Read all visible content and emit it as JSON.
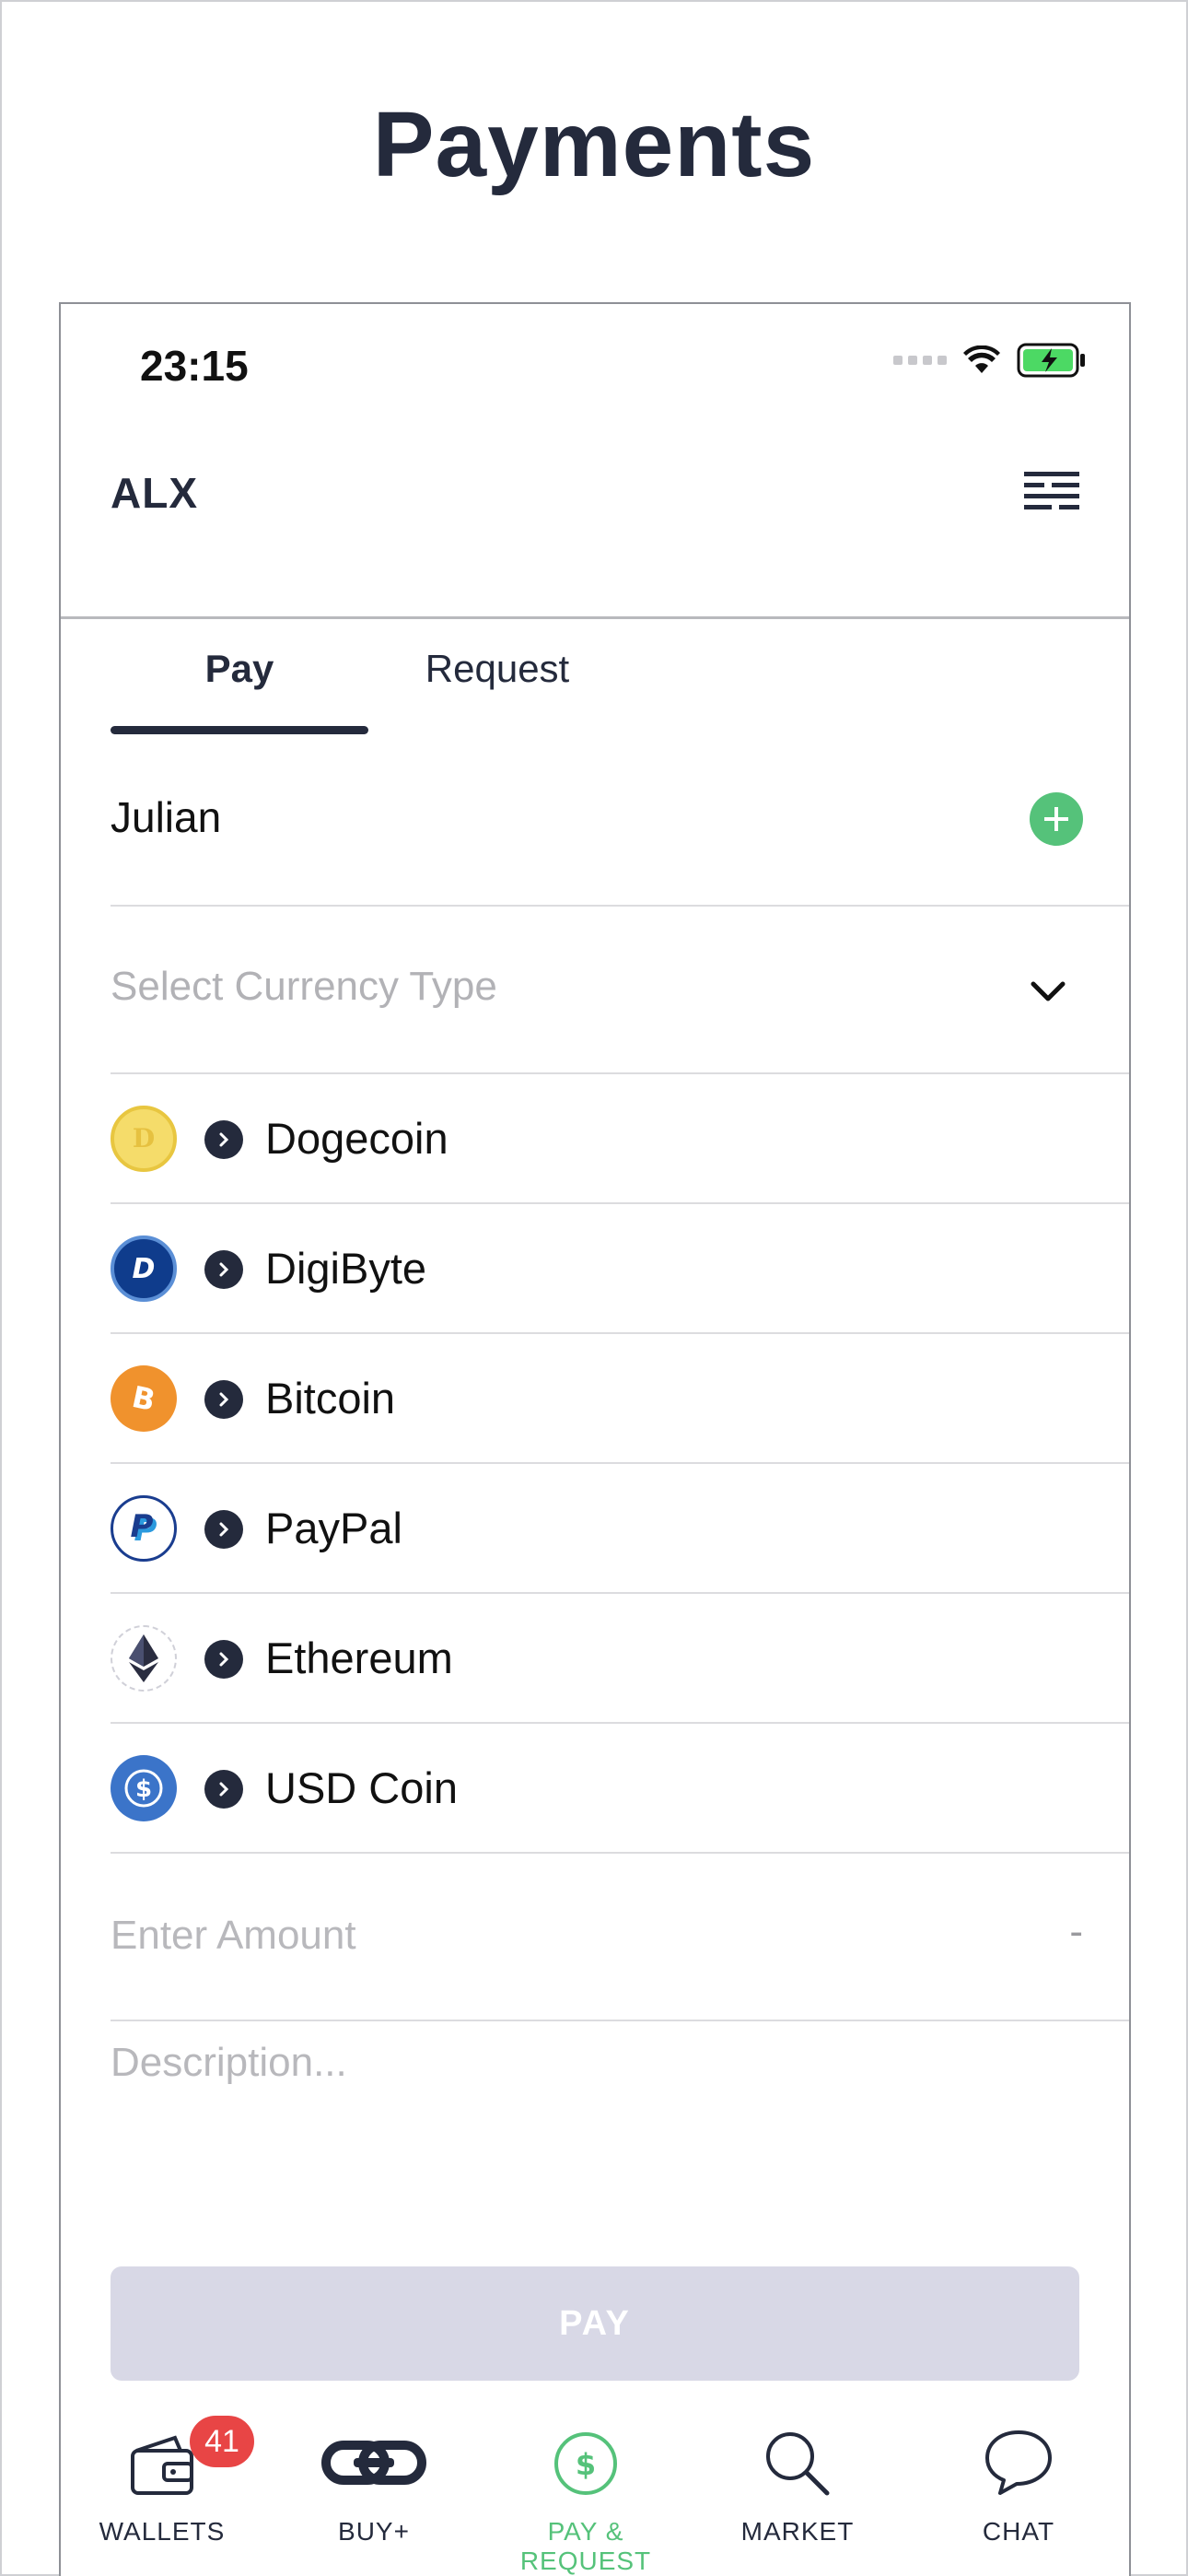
{
  "page": {
    "title": "Payments"
  },
  "status_bar": {
    "time": "23:15"
  },
  "header": {
    "brand": "ALX",
    "menu_icon": "menu-lines-icon"
  },
  "tabs": [
    {
      "label": "Pay",
      "active": true
    },
    {
      "label": "Request",
      "active": false
    }
  ],
  "recipient": {
    "name": "Julian",
    "add_icon": "plus-icon"
  },
  "currency_select": {
    "placeholder": "Select Currency Type",
    "icon": "chevron-down-icon"
  },
  "currencies": [
    {
      "name": "Dogecoin",
      "icon": "dogecoin-icon",
      "color": "#f2d45c"
    },
    {
      "name": "DigiByte",
      "icon": "digibyte-icon",
      "color": "#0f3c8c"
    },
    {
      "name": "Bitcoin",
      "icon": "bitcoin-icon",
      "color": "#f0922d"
    },
    {
      "name": "PayPal",
      "icon": "paypal-icon",
      "color": "#1a3d8f"
    },
    {
      "name": "Ethereum",
      "icon": "ethereum-icon",
      "color": "#2a2d40"
    },
    {
      "name": "USD Coin",
      "icon": "usdc-icon",
      "color": "#3b74c9"
    }
  ],
  "amount": {
    "placeholder": "Enter Amount",
    "suffix": "-"
  },
  "description": {
    "placeholder": "Description..."
  },
  "pay_button": {
    "label": "PAY"
  },
  "bottom_nav": [
    {
      "label": "WALLETS",
      "icon": "wallet-icon",
      "badge": "41",
      "active": false
    },
    {
      "label": "BUY+",
      "icon": "link-icon",
      "active": false
    },
    {
      "label": "PAY & REQUEST",
      "icon": "dollar-circle-icon",
      "active": true
    },
    {
      "label": "MARKET",
      "icon": "search-icon",
      "active": false
    },
    {
      "label": "CHAT",
      "icon": "chat-bubble-icon",
      "active": false
    }
  ],
  "colors": {
    "primary": "#242a3c",
    "accent_green": "#55c27a",
    "badge_red": "#e84545",
    "disabled_button": "#d8d8e6"
  }
}
